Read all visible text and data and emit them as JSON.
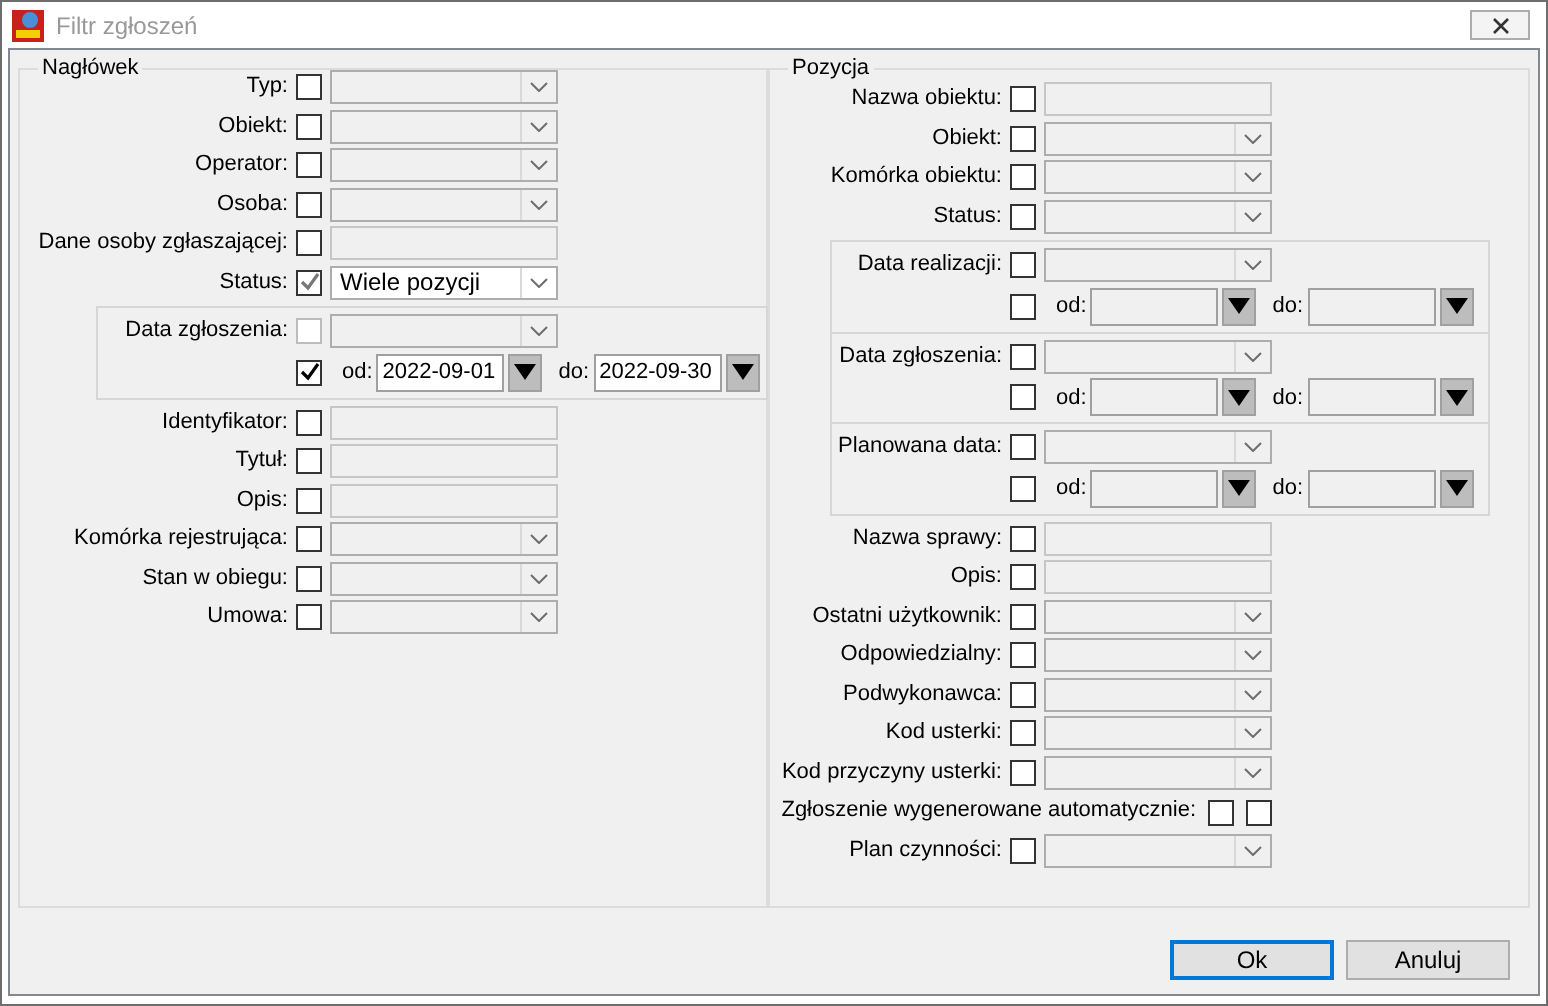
{
  "window": {
    "title": "Filtr zgłoszeń"
  },
  "naglowek": {
    "title": "Nagłówek",
    "rows": [
      {
        "kind": "combo",
        "label": "Typ:",
        "checked": false
      },
      {
        "kind": "combo",
        "label": "Obiekt:",
        "checked": false
      },
      {
        "kind": "combo",
        "label": "Operator:",
        "checked": false
      },
      {
        "kind": "combo",
        "label": "Osoba:",
        "checked": false
      },
      {
        "kind": "text",
        "label": "Dane osoby zgłaszającej:",
        "checked": false
      },
      {
        "kind": "combo",
        "label": "Status:",
        "checked": true,
        "value": "Wiele pozycji"
      },
      {
        "kind": "dates",
        "items": [
          {
            "label": "Data zgłoszenia:",
            "disabled": true,
            "checked": false,
            "range_checked": true,
            "from_label": "od:",
            "from": "2022-09-01",
            "to_label": "do:",
            "to": "2022-09-30"
          }
        ]
      },
      {
        "kind": "text",
        "label": "Identyfikator:",
        "checked": false
      },
      {
        "kind": "text",
        "label": "Tytuł:",
        "checked": false
      },
      {
        "kind": "text",
        "label": "Opis:",
        "checked": false
      },
      {
        "kind": "combo",
        "label": "Komórka rejestrująca:",
        "checked": false
      },
      {
        "kind": "combo",
        "label": "Stan w obiegu:",
        "checked": false
      },
      {
        "kind": "combo",
        "label": "Umowa:",
        "checked": false
      }
    ]
  },
  "pozycja": {
    "title": "Pozycja",
    "rows": [
      {
        "kind": "text",
        "label": "Nazwa obiektu:",
        "checked": false
      },
      {
        "kind": "combo",
        "label": "Obiekt:",
        "checked": false
      },
      {
        "kind": "combo",
        "label": "Komórka obiektu:",
        "checked": false
      },
      {
        "kind": "combo",
        "label": "Status:",
        "checked": false
      },
      {
        "kind": "dates",
        "items": [
          {
            "label": "Data realizacji:",
            "disabled": false,
            "checked": false,
            "range_checked": false,
            "from_label": "od:",
            "to_label": "do:"
          },
          {
            "label": "Data zgłoszenia:",
            "disabled": false,
            "checked": false,
            "range_checked": false,
            "from_label": "od:",
            "to_label": "do:"
          },
          {
            "label": "Planowana data:",
            "disabled": false,
            "checked": false,
            "range_checked": false,
            "from_label": "od:",
            "to_label": "do:"
          }
        ]
      },
      {
        "kind": "text",
        "label": "Nazwa sprawy:",
        "checked": false
      },
      {
        "kind": "text",
        "label": "Opis:",
        "checked": false
      },
      {
        "kind": "combo",
        "label": "Ostatni użytkownik:",
        "checked": false
      },
      {
        "kind": "combo",
        "label": "Odpowiedzialny:",
        "checked": false
      },
      {
        "kind": "combo",
        "label": "Podwykonawca:",
        "checked": false
      },
      {
        "kind": "combo",
        "label": "Kod usterki:",
        "checked": false
      },
      {
        "kind": "combo",
        "label": "Kod przyczyny usterki:",
        "checked": false
      },
      {
        "kind": "double_check",
        "label": "Zgłoszenie wygenerowane automatycznie:",
        "checked": false,
        "checked_2": false
      },
      {
        "kind": "combo",
        "label": "Plan czynności:",
        "checked": false
      }
    ]
  },
  "buttons": [
    {
      "label": "Ok",
      "default": true
    },
    {
      "label": "Anuluj",
      "default": false
    }
  ]
}
